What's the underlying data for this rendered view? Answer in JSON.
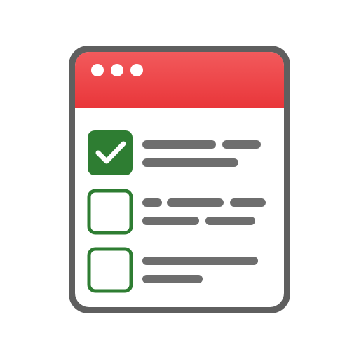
{
  "icon": {
    "name": "checklist-window-icon",
    "colors": {
      "frame": "#5f5f5f",
      "page": "#ffffff",
      "header_top": "#f25a5c",
      "header_bottom": "#e9363a",
      "header_dots": "#ffffff",
      "check_fill": "#2e7d32",
      "check_stroke": "#2e7d32",
      "check_mark": "#ffffff",
      "text_line": "#6e6e6e"
    },
    "window_controls": [
      {
        "name": "window-dot-1-icon"
      },
      {
        "name": "window-dot-2-icon"
      },
      {
        "name": "window-dot-3-icon"
      }
    ],
    "checklist": [
      {
        "name": "checklist-item-1",
        "checked": true
      },
      {
        "name": "checklist-item-2",
        "checked": false
      },
      {
        "name": "checklist-item-3",
        "checked": false
      }
    ]
  }
}
